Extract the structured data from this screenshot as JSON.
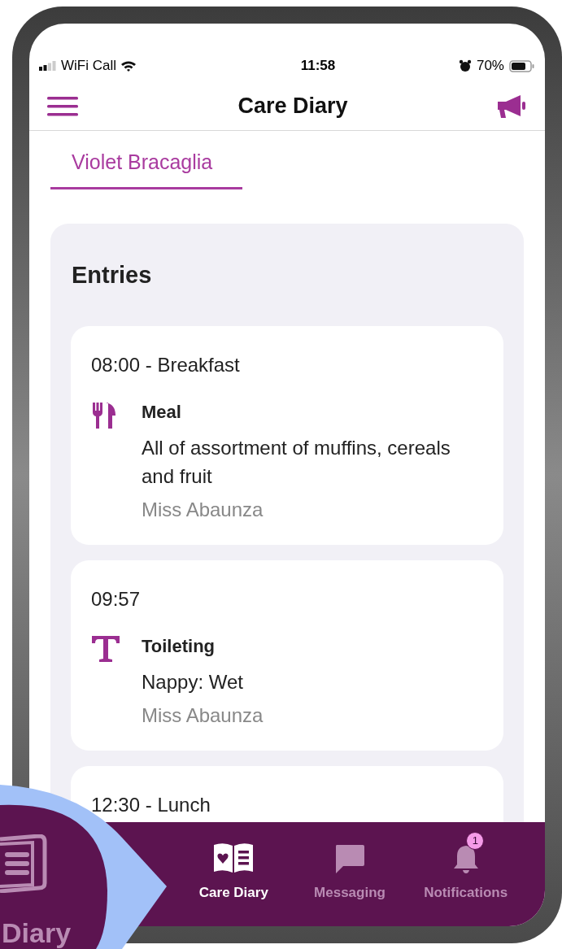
{
  "status_bar": {
    "carrier": "WiFi Call",
    "time": "11:58",
    "battery": "70%"
  },
  "header": {
    "title": "Care Diary"
  },
  "child_tabs": [
    {
      "label": "Violet Bracaglia",
      "selected": true
    }
  ],
  "entries_panel": {
    "title": "Entries",
    "entries": [
      {
        "time": "08:00 - Breakfast",
        "kind": "meal",
        "category": "Meal",
        "description": "All of assortment of muffins, cereals and fruit",
        "author": "Miss Abaunza"
      },
      {
        "time": "09:57",
        "kind": "toileting",
        "category": "Toileting",
        "description": "Nappy: Wet",
        "author": "Miss Abaunza"
      },
      {
        "time": "12:30 - Lunch"
      }
    ]
  },
  "bottom_nav": [
    {
      "kind": "diary",
      "label": "Care Diary",
      "selected": true
    },
    {
      "kind": "messaging",
      "label": "Messaging",
      "selected": false
    },
    {
      "kind": "notifications",
      "label": "Notifications",
      "selected": false,
      "badge": "1"
    }
  ],
  "zoom_callout": {
    "label": "Diary"
  }
}
